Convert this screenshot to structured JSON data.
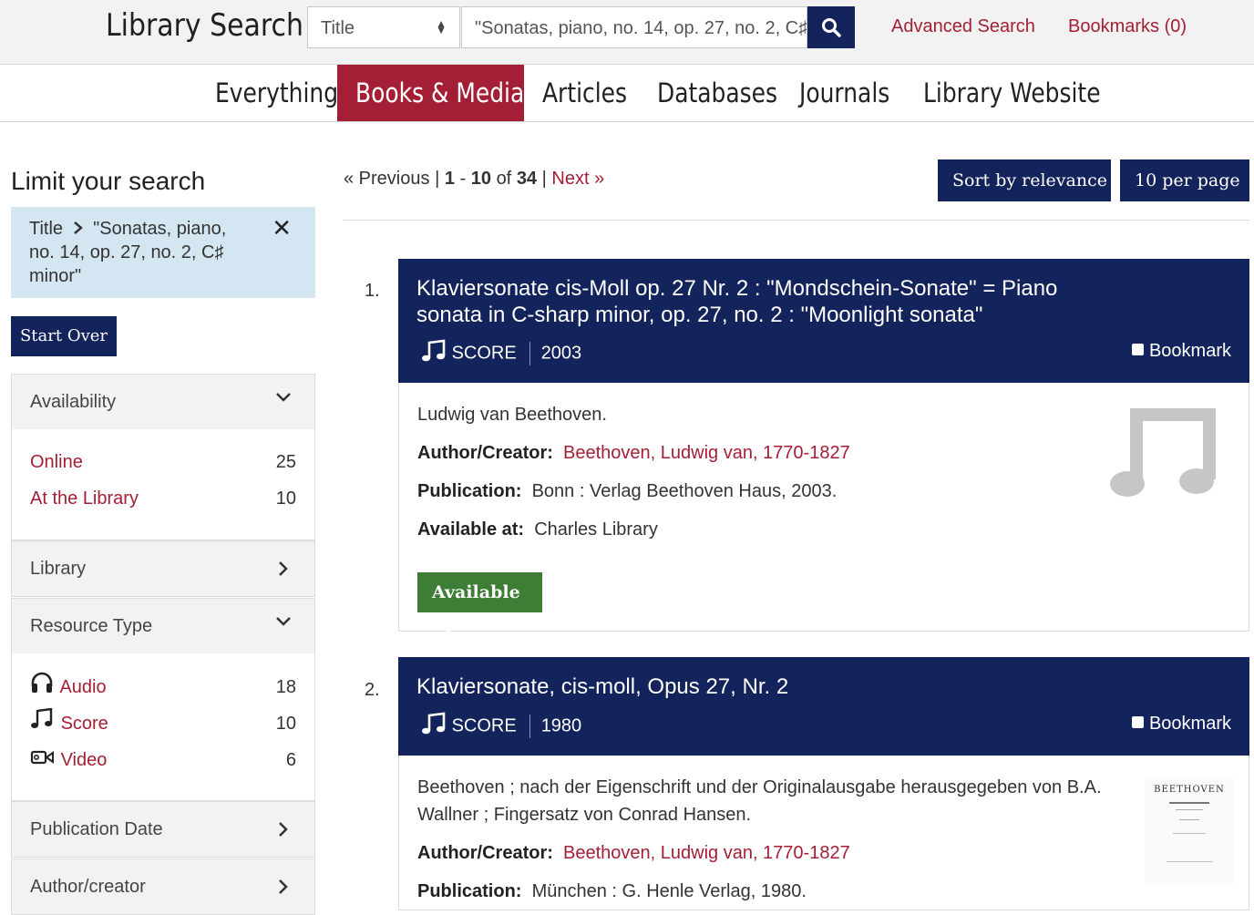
{
  "header": {
    "brand": "Library Search",
    "field_select": "Title",
    "search_value": "\"Sonatas, piano, no. 14, op. 27, no. 2, C♯",
    "advanced_search": "Advanced Search",
    "bookmarks": "Bookmarks (0)"
  },
  "tabs": [
    {
      "label": "Everything"
    },
    {
      "label": "Books & Media",
      "active": true
    },
    {
      "label": "Articles"
    },
    {
      "label": "Databases"
    },
    {
      "label": "Journals"
    },
    {
      "label": "Library Website"
    }
  ],
  "sidebar": {
    "title": "Limit your search",
    "constraint": {
      "field": "Title",
      "value": "\"Sonatas, piano, no. 14, op. 27, no. 2, C♯ minor\""
    },
    "start_over": "Start Over",
    "facets": {
      "availability": {
        "label": "Availability",
        "items": [
          {
            "label": "Online",
            "count": "25"
          },
          {
            "label": "At the Library",
            "count": "10"
          }
        ]
      },
      "library": {
        "label": "Library"
      },
      "resource_type": {
        "label": "Resource Type",
        "items": [
          {
            "label": "Audio",
            "count": "18",
            "icon": "headphones-icon"
          },
          {
            "label": "Score",
            "count": "10",
            "icon": "music-note-icon"
          },
          {
            "label": "Video",
            "count": "6",
            "icon": "video-camera-icon"
          }
        ]
      },
      "publication_date": {
        "label": "Publication Date"
      },
      "author_creator": {
        "label": "Author/creator"
      }
    }
  },
  "pager": {
    "previous": "« Previous",
    "sep": "|",
    "start": "1",
    "dash": "-",
    "end": "10",
    "of": "of",
    "total": "34",
    "next": "Next »"
  },
  "sort": {
    "label": "Sort by relevance"
  },
  "per_page": {
    "label": "10 per page"
  },
  "results": [
    {
      "number": "1.",
      "title_line1": "Klaviersonate cis-Moll op. 27 Nr. 2 : \"Mondschein-Sonate\" = Piano",
      "title_line2": "sonata in C-sharp minor, op. 27, no. 2 : \"Moonlight sonata\"",
      "format": "SCORE",
      "year": "2003",
      "bookmark": "Bookmark",
      "statement": "Ludwig van Beethoven.",
      "author_label": "Author/Creator:",
      "author": "Beethoven, Ludwig van, 1770-1827",
      "publication_label": "Publication:",
      "publication": "Bonn : Verlag Beethoven Haus, 2003.",
      "available_at_label": "Available at:",
      "available_at": "Charles Library",
      "status": "Available"
    },
    {
      "number": "2.",
      "title_line1": "Klaviersonate, cis-moll, Opus 27, Nr. 2",
      "format": "SCORE",
      "year": "1980",
      "bookmark": "Bookmark",
      "statement_line1": "Beethoven ; nach der Eigenschrift und der Originalausgabe herausgegeben von B.A.",
      "statement_line2": "Wallner ; Fingersatz von Conrad Hansen.",
      "author_label": "Author/Creator:",
      "author": "Beethoven, Ludwig van, 1770-1827",
      "publication_label": "Publication:",
      "publication": "München : G. Henle Verlag, 1980.",
      "thumb_text": "BEETHOVEN"
    }
  ],
  "colors": {
    "navy": "#13235b",
    "crimson": "#a41e35",
    "green": "#3d7d36",
    "constraint_bg": "#d4e6f1"
  }
}
